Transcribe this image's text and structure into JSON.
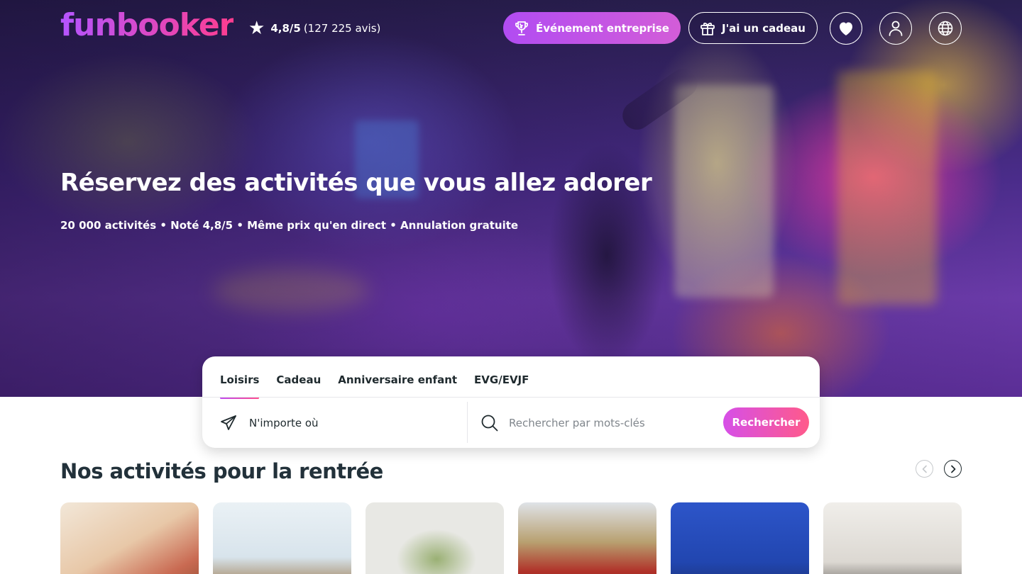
{
  "header": {
    "logo_text": "funbooker",
    "rating_score": "4,8/5",
    "rating_count": "(127 225 avis)",
    "corporate_label": "Événement entreprise",
    "gift_label": "J'ai un cadeau"
  },
  "hero": {
    "title": "Réservez des activités que vous allez adorer",
    "subtitle": "20 000 activités • Noté 4,8/5 • Même prix qu'en direct • Annulation gratuite"
  },
  "search": {
    "tabs": [
      {
        "label": "Loisirs",
        "active": true
      },
      {
        "label": "Cadeau",
        "active": false
      },
      {
        "label": "Anniversaire enfant",
        "active": false
      },
      {
        "label": "EVG/EVJF",
        "active": false
      }
    ],
    "location_label": "N'importe où",
    "keyword_placeholder": "Rechercher par mots-clés",
    "search_button": "Rechercher"
  },
  "section": {
    "title": "Nos activités pour la rentrée"
  },
  "colors": {
    "brand_gradient_start": "#b455ff",
    "brand_gradient_end": "#ff3d8f",
    "text_dark": "#1f2a2e"
  },
  "icons": [
    "star-icon",
    "trophy-icon",
    "gift-icon",
    "heart-icon",
    "user-icon",
    "globe-icon",
    "paper-plane-icon",
    "search-icon",
    "chevron-left-icon",
    "chevron-right-icon"
  ]
}
